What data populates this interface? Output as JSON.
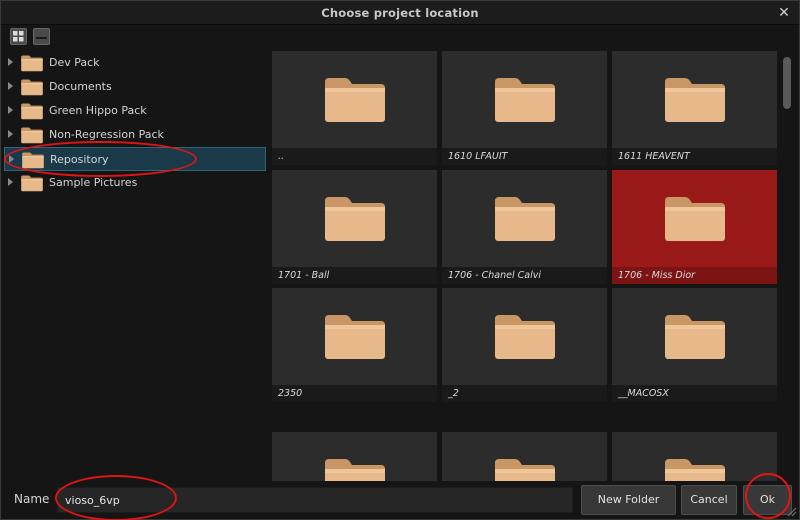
{
  "window": {
    "title": "Choose project location",
    "close_glyph": "✕"
  },
  "toolbar": {
    "grid_view_icon": "grid-view-icon",
    "list_view_icon": "list-view-icon"
  },
  "tree": {
    "items": [
      {
        "label": "Dev Pack",
        "selected": false
      },
      {
        "label": "Documents",
        "selected": false
      },
      {
        "label": "Green Hippo Pack",
        "selected": false
      },
      {
        "label": "Non-Regression Pack",
        "selected": false
      },
      {
        "label": "Repository",
        "selected": true
      },
      {
        "label": "Sample Pictures",
        "selected": false
      }
    ]
  },
  "grid": {
    "tiles": [
      {
        "caption": "..",
        "selected": false
      },
      {
        "caption": "1610 LFAUIT",
        "selected": false
      },
      {
        "caption": "1611 HEAVENT",
        "selected": false
      },
      {
        "caption": "1701 - Ball",
        "selected": false
      },
      {
        "caption": "1706 - Chanel Calvi",
        "selected": false
      },
      {
        "caption": "1706 - Miss Dior",
        "selected": true
      },
      {
        "caption": "2350",
        "selected": false
      },
      {
        "caption": "_2",
        "selected": false
      },
      {
        "caption": "__MACOSX",
        "selected": false
      },
      {
        "caption": "",
        "selected": false
      },
      {
        "caption": "",
        "selected": false
      },
      {
        "caption": "",
        "selected": false
      }
    ]
  },
  "footer": {
    "name_label": "Name",
    "name_value": "vioso_6vp",
    "new_folder_label": "New Folder",
    "cancel_label": "Cancel",
    "ok_label": "Ok"
  },
  "colors": {
    "selection_tile": "#9a1a1a",
    "selection_tree": "#1a3a4a",
    "annotation": "#e01515",
    "folder": "#e8b98a"
  }
}
